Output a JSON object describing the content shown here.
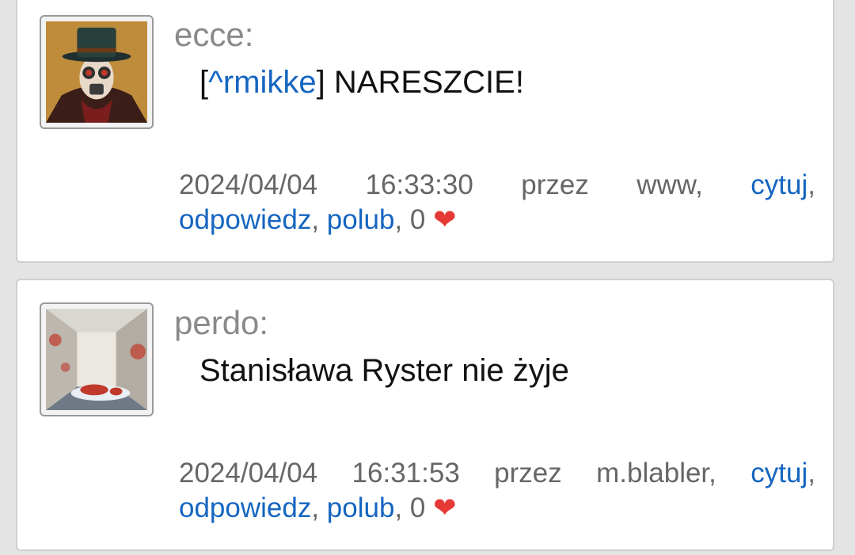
{
  "posts": [
    {
      "author": "ecce:",
      "mention_open": "[",
      "mention": "^rmikke",
      "mention_close": "]",
      "text": " NARESZCIE!",
      "date": "2024/04/04",
      "time": "16:33:30",
      "przez": "przez",
      "via": "www,",
      "quote": "cytuj",
      "reply": "odpowiedz",
      "like": "polub",
      "likes": "0",
      "heart_icon": "heart-icon"
    },
    {
      "author": "perdo:",
      "text": "Stanisława Ryster nie żyje",
      "date": "2024/04/04",
      "time": "16:31:53",
      "przez": "przez",
      "via": "m.blabler,",
      "quote": "cytuj",
      "reply": "odpowiedz",
      "like": "polub",
      "likes": "0",
      "heart_icon": "heart-icon"
    }
  ],
  "colors": {
    "link": "#1565c0",
    "heart": "#e53935",
    "author": "#8a8a8a",
    "meta": "#666666"
  }
}
